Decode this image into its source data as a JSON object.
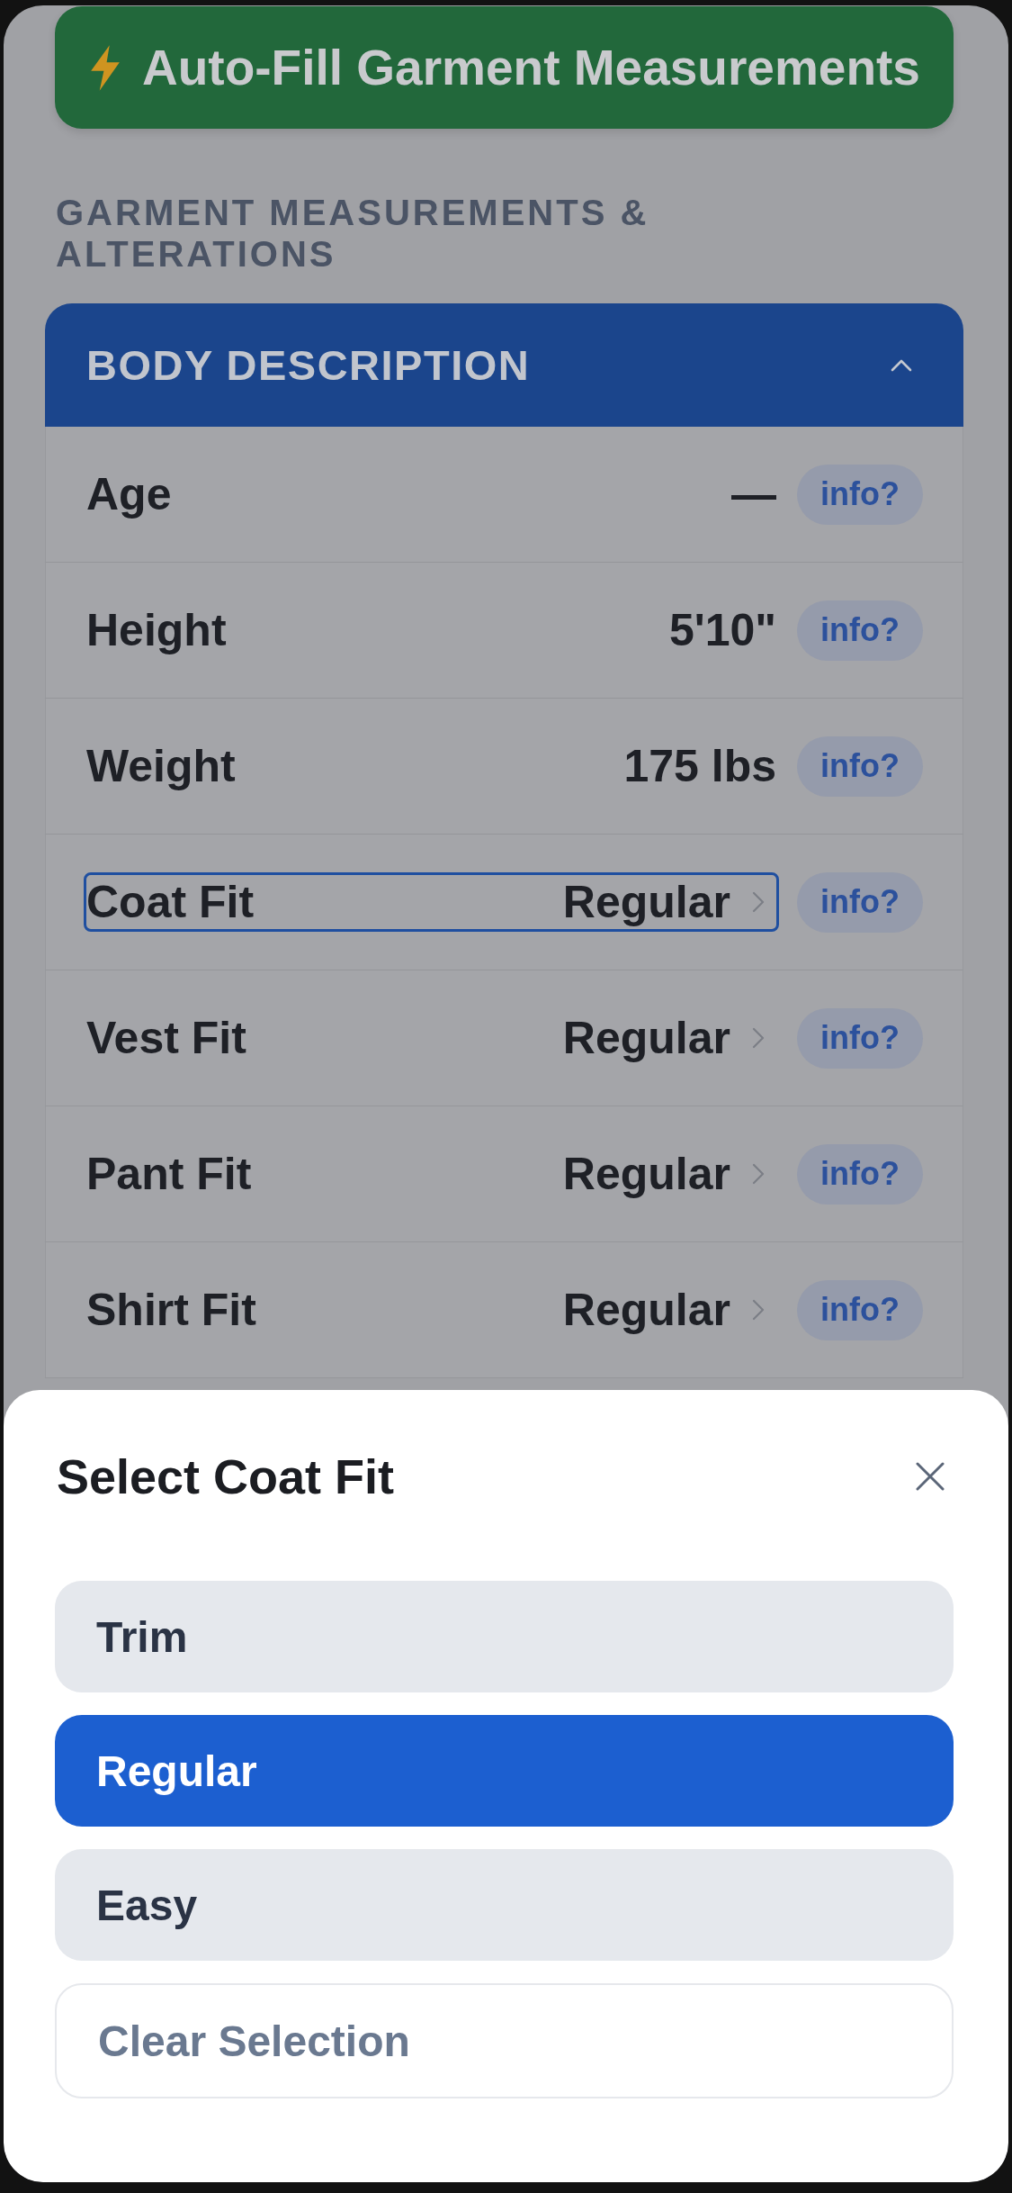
{
  "autofill_button": {
    "label": "Auto-Fill Garment Measurements"
  },
  "section_heading": "GARMENT MEASUREMENTS & ALTERATIONS",
  "panel": {
    "title": "BODY DESCRIPTION",
    "expanded": true,
    "rows": [
      {
        "label": "Age",
        "value": "—",
        "kind": "text",
        "focused": false,
        "info": "info?"
      },
      {
        "label": "Height",
        "value": "5'10\"",
        "kind": "text",
        "focused": false,
        "info": "info?"
      },
      {
        "label": "Weight",
        "value": "175 lbs",
        "kind": "text",
        "focused": false,
        "info": "info?"
      },
      {
        "label": "Coat Fit",
        "value": "Regular",
        "kind": "select",
        "focused": true,
        "info": "info?"
      },
      {
        "label": "Vest Fit",
        "value": "Regular",
        "kind": "select",
        "focused": false,
        "info": "info?"
      },
      {
        "label": "Pant Fit",
        "value": "Regular",
        "kind": "select",
        "focused": false,
        "info": "info?"
      },
      {
        "label": "Shirt Fit",
        "value": "Regular",
        "kind": "select",
        "focused": false,
        "info": "info?"
      }
    ]
  },
  "sheet": {
    "title": "Select Coat Fit",
    "options": [
      {
        "label": "Trim",
        "selected": false
      },
      {
        "label": "Regular",
        "selected": true
      },
      {
        "label": "Easy",
        "selected": false
      }
    ],
    "clear_label": "Clear Selection"
  }
}
